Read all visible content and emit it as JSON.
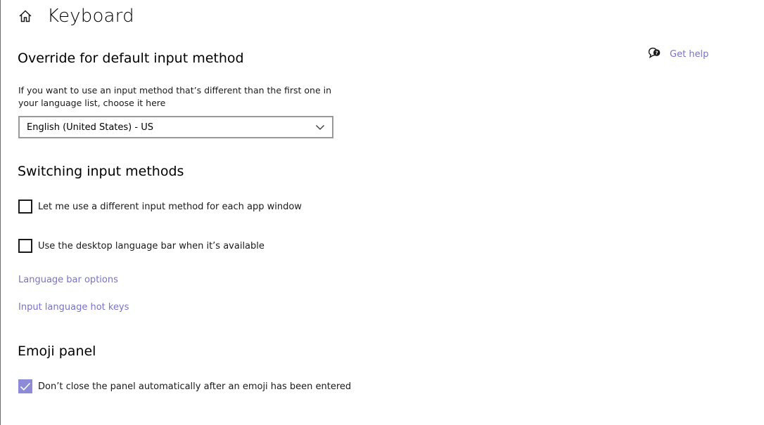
{
  "header": {
    "title": "Keyboard",
    "home_icon": "home-icon"
  },
  "help": {
    "label": "Get help",
    "icon": "chat-help-icon"
  },
  "override": {
    "heading": "Override for default input method",
    "description": "If you want to use an input method that’s different than the first one in your language list, choose it here",
    "selected": "English (United States) - US"
  },
  "switching": {
    "heading": "Switching input methods",
    "option1_label": "Let me use a different input method for each app window",
    "option1_checked": false,
    "option2_label": "Use the desktop language bar when it’s available",
    "option2_checked": false,
    "link1": "Language bar options",
    "link2": "Input language hot keys"
  },
  "emoji": {
    "heading": "Emoji panel",
    "option_label": "Don’t close the panel automatically after an emoji has been entered",
    "option_checked": true
  },
  "colors": {
    "accent": "#8d8ad8",
    "link": "#7872c8"
  }
}
